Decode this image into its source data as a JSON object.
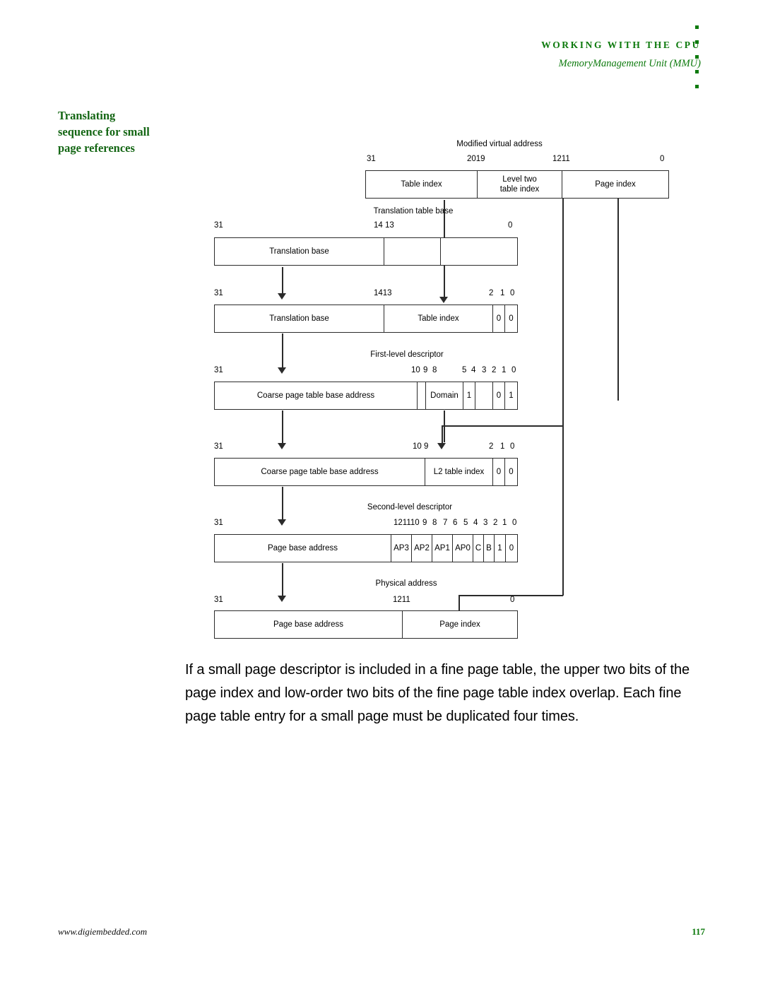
{
  "header": {
    "title": "WORKING WITH THE CPU",
    "subtitle": "MemoryManagement Unit (MMU)",
    "accent_color": "#0d7a0d"
  },
  "section": {
    "heading_line1": "Translating",
    "heading_line2": "sequence for small",
    "heading_line3": "page references"
  },
  "diagram": {
    "rows": [
      {
        "caption": "Modified virtual address",
        "bits": [
          "31",
          "2019",
          "1211",
          "0"
        ],
        "fields": [
          "Table index",
          "Level two\ntable index",
          "Page  index"
        ]
      },
      {
        "caption": "Translation table base",
        "bits": [
          "31",
          "14 13",
          "0"
        ],
        "fields": [
          "Translation base",
          "",
          ""
        ]
      },
      {
        "caption": "",
        "bits": [
          "31",
          "1413",
          "2",
          "1",
          "0"
        ],
        "fields": [
          "Translation base",
          "Table index",
          "0",
          "0"
        ]
      },
      {
        "caption": "First-level descriptor",
        "bits": [
          "31",
          "10",
          "9",
          "8",
          "5",
          "4",
          "3",
          "2",
          "1",
          "0"
        ],
        "fields": [
          "Coarse page table base address",
          "",
          "Domain",
          "1",
          "",
          "0",
          "1"
        ]
      },
      {
        "caption": "",
        "bits": [
          "31",
          "10",
          "9",
          "2",
          "1",
          "0"
        ],
        "fields": [
          "Coarse page table base address",
          "L2 table index",
          "0",
          "0"
        ]
      },
      {
        "caption": "Second-level descriptor",
        "bits": [
          "31",
          "12",
          "11",
          "10",
          "9",
          "8",
          "7",
          "6",
          "5",
          "4",
          "3",
          "2",
          "1",
          "0"
        ],
        "fields": [
          "Page base address",
          "AP3",
          "AP2",
          "AP1",
          "AP0",
          "C",
          "B",
          "1",
          "0"
        ]
      },
      {
        "caption": "Physical address",
        "bits": [
          "31",
          "1211",
          "0"
        ],
        "fields": [
          "Page base address",
          "Page index"
        ]
      }
    ],
    "labels": {
      "modified_virtual_address": "Modified virtual address",
      "translation_table_base": "Translation table base",
      "first_level_descriptor": "First-level descriptor",
      "second_level_descriptor": "Second-level descriptor",
      "physical_address": "Physical address",
      "table_index": "Table index",
      "level_two_line1": "Level two",
      "level_two_line2": "table index",
      "page_index_spaced": "Page  index",
      "translation_base": "Translation base",
      "coarse_page_table_base_address": "Coarse page table base address",
      "domain": "Domain",
      "l2_table_index": "L2 table index",
      "page_base_address": "Page base address",
      "page_index": "Page index",
      "ap3": "AP3",
      "ap2": "AP2",
      "ap1": "AP1",
      "ap0": "AP0",
      "c": "C",
      "b": "B",
      "zero": "0",
      "one": "1",
      "b31": "31",
      "b2019": "2019",
      "b1211": "1211",
      "b0": "0",
      "b14_13": "14 13",
      "b1413": "1413",
      "b2": "2",
      "b1": "1",
      "b10": "10",
      "b9": "9",
      "b8": "8",
      "b5": "5",
      "b4": "4",
      "b3": "3",
      "b109": "10 9",
      "b12": "12",
      "b11": "11",
      "b6": "6",
      "b7": "7",
      "b121110": "121110"
    }
  },
  "body": {
    "paragraph": "If a small page descriptor is included in a fine page table, the upper two bits of the page index and low-order two bits of the fine page table index overlap. Each fine page table entry for a small page must be duplicated four times."
  },
  "footer": {
    "site": "www.digiembedded.com",
    "page_number": "117"
  }
}
